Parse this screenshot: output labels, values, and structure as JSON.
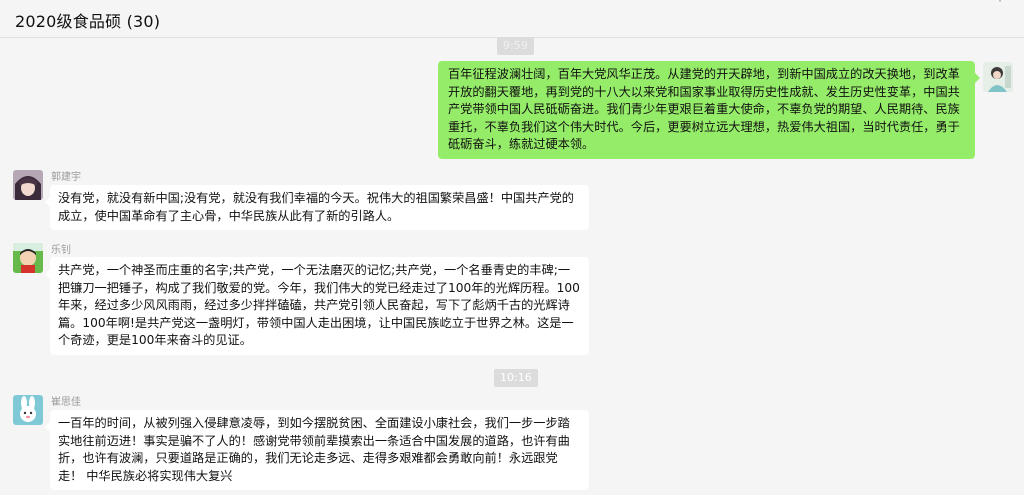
{
  "window": {
    "title": "2020级食品硕 (30)"
  },
  "timestamps": {
    "top": "9:59",
    "middle": "10:16"
  },
  "messages": [
    {
      "side": "right",
      "sender": "",
      "text": "百年征程波澜壮阔，百年大党风华正茂。从建党的开天辟地，到新中国成立的改天换地，到改革开放的翻天覆地，再到党的十八大以来党和国家事业取得历史性成就、发生历史性变革，中国共产党带领中国人民砥砺奋进。我们青少年更艰巨着重大使命，不辜负党的期望、人民期待、民族重托，不辜负我们这个伟大时代。今后，更要树立远大理想，热爱伟大祖国，当时代责任，勇于砥砺奋斗，练就过硬本领。"
    },
    {
      "side": "left",
      "sender": "郭建宇",
      "text": "没有党，就没有新中国;没有党，就没有我们幸福的今天。祝伟大的祖国繁荣昌盛！中国共产党的成立，使中国革命有了主心骨，中华民族从此有了新的引路人。"
    },
    {
      "side": "left",
      "sender": "乐钊",
      "text": "共产党，一个神圣而庄重的名字;共产党，一个无法磨灭的记忆;共产党，一个名垂青史的丰碑;一把镰刀一把锤子，构成了我们敬爱的党。今年，我们伟大的党已经走过了100年的光辉历程。100年来，经过多少风风雨雨，经过多少拌拌磕磕，共产党引领人民奋起，写下了彪炳千古的光辉诗篇。100年啊!是共产党这一盏明灯，带领中国人走出困境，让中国民族屹立于世界之林。这是一个奇迹，更是100年来奋斗的见证。"
    },
    {
      "side": "left",
      "sender": "崔思佳",
      "text": "一百年的时间，从被列强入侵肆意凌辱，到如今摆脱贫困、全面建设小康社会，我们一步一步踏实地往前迈进！事实是骗不了人的！感谢党带领前辈摸索出一条适合中国发展的道路，也许有曲折，也许有波澜，只要道路是正确的，我们无论走多远、走得多艰难都会勇敢向前！永远跟党走！ 中华民族必将实现伟大复兴"
    }
  ],
  "colors": {
    "self_bubble": "#95ec69",
    "other_bubble": "#ffffff",
    "background": "#f5f5f5"
  }
}
